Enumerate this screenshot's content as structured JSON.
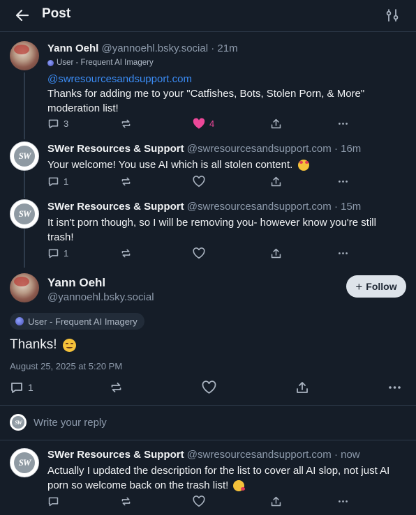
{
  "header": {
    "title": "Post"
  },
  "posts": [
    {
      "author": "Yann Oehl",
      "handle": "@yannoehl.bsky.social",
      "time": "· 21m",
      "label": "User - Frequent AI Imagery",
      "mention": "@swresourcesandsupport.com",
      "text": "Thanks for adding me to your \"Catfishes, Bots, Stolen Porn, & More\" moderation list!",
      "replies": "3",
      "likes": "4"
    },
    {
      "author": "SWer Resources & Support",
      "handle": "@swresourcesandsupport.com",
      "time": "· 16m",
      "text": "Your welcome! You use AI which is all stolen content.",
      "replies": "1"
    },
    {
      "author": "SWer Resources & Support",
      "handle": "@swresourcesandsupport.com",
      "time": "· 15m",
      "text": "It isn't porn though, so I will be removing you- however know you're still trash!",
      "replies": "1"
    }
  ],
  "main_post": {
    "author": "Yann Oehl",
    "handle": "@yannoehl.bsky.social",
    "follow_label": "Follow",
    "label": "User - Frequent AI Imagery",
    "text": "Thanks!",
    "date": "August 25, 2025 at 5:20 PM",
    "replies": "1"
  },
  "reply": {
    "placeholder": "Write your reply",
    "avatar_text": "SW"
  },
  "reply_post": {
    "author": "SWer Resources & Support",
    "handle": "@swresourcesandsupport.com",
    "time": "· now",
    "text": "Actually I updated the description for the list to cover all AI slop, not just AI porn so welcome back on the trash list!"
  },
  "logo_text": "SW",
  "colors": {
    "accent": "#3b8cf5",
    "like": "#ec4899",
    "background": "#151d28"
  }
}
